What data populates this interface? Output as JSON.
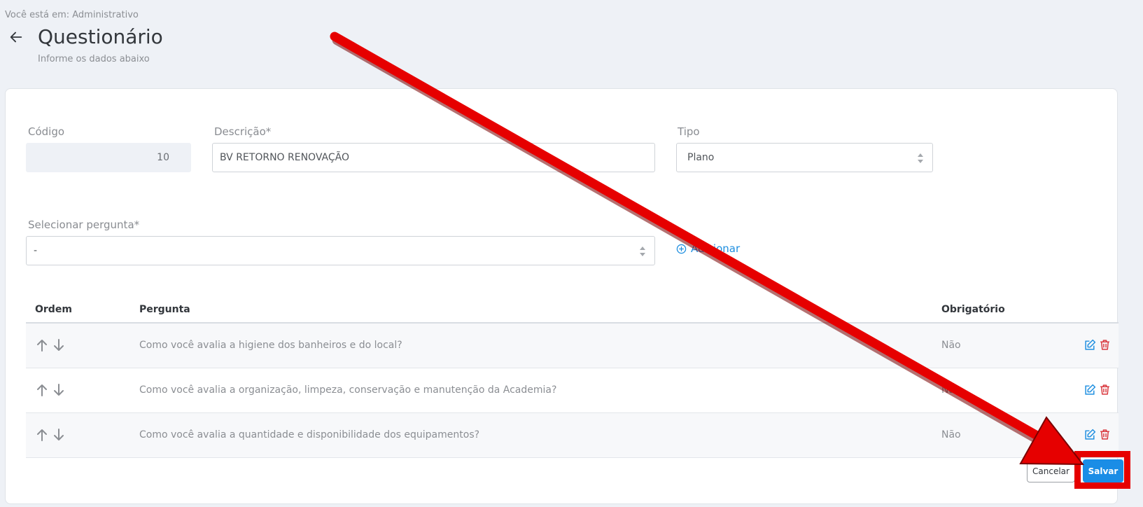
{
  "breadcrumb": "Você está em: Administrativo",
  "title": "Questionário",
  "subtitle": "Informe os dados abaixo",
  "form": {
    "codigo": {
      "label": "Código",
      "value": "10"
    },
    "descricao": {
      "label": "Descrição*",
      "value": "BV RETORNO RENOVAÇÃO"
    },
    "tipo": {
      "label": "Tipo",
      "value": "Plano"
    },
    "pergunta": {
      "label": "Selecionar pergunta*",
      "value": "-"
    },
    "add_label": "Adicionar"
  },
  "table": {
    "headers": {
      "ordem": "Ordem",
      "pergunta": "Pergunta",
      "obrigatorio": "Obrigatório"
    },
    "rows": [
      {
        "pergunta": "Como você avalia a higiene dos banheiros e do local?",
        "obrigatorio": "Não"
      },
      {
        "pergunta": "Como você avalia a organização, limpeza, conservação e manutenção da Academia?",
        "obrigatorio": "Não"
      },
      {
        "pergunta": "Como você avalia a quantidade e disponibilidade dos equipamentos?",
        "obrigatorio": "Não"
      }
    ]
  },
  "buttons": {
    "cancel": "Cancelar",
    "save": "Salvar"
  },
  "colors": {
    "accent": "#1a8de6",
    "annotation": "#e60000",
    "delete": "#d9373d"
  },
  "icons": [
    "arrow-left-icon",
    "select-arrows-icon",
    "plus-circle-icon",
    "arrow-up-icon",
    "arrow-down-icon",
    "edit-icon",
    "trash-icon"
  ]
}
